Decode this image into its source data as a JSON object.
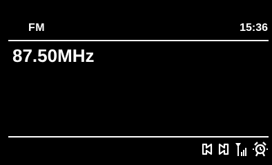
{
  "header": {
    "mode": "FM",
    "time": "15:36"
  },
  "main": {
    "frequency": "87.50MHz"
  },
  "status_bar": {
    "icons": [
      "stereo-icon",
      "signal-strength-icon",
      "alarm-icon"
    ]
  }
}
